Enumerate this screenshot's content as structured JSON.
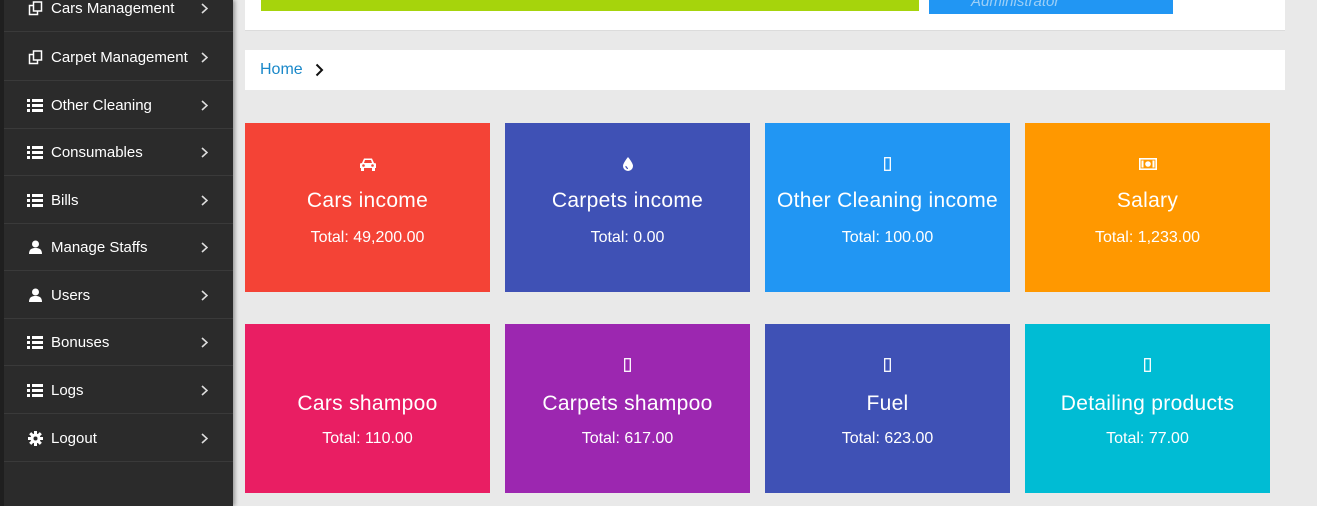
{
  "sidebar": {
    "items": [
      {
        "label": "Cars Management",
        "icon": "copy-icon"
      },
      {
        "label": "Carpet Management",
        "icon": "copy-icon"
      },
      {
        "label": "Other Cleaning",
        "icon": "list-icon"
      },
      {
        "label": "Consumables",
        "icon": "list-icon"
      },
      {
        "label": "Bills",
        "icon": "list-icon"
      },
      {
        "label": "Manage Staffs",
        "icon": "user-icon"
      },
      {
        "label": "Users",
        "icon": "user-icon"
      },
      {
        "label": "Bonuses",
        "icon": "list-icon"
      },
      {
        "label": "Logs",
        "icon": "list-icon"
      },
      {
        "label": "Logout",
        "icon": "gear-icon"
      }
    ]
  },
  "header": {
    "user_role": "Administrator"
  },
  "breadcrumb": {
    "home": "Home"
  },
  "cards": [
    {
      "title": "Cars income",
      "total": "Total: 49,200.00",
      "color": "#f44336",
      "icon": "car-icon"
    },
    {
      "title": "Carpets income",
      "total": "Total: 0.00",
      "color": "#3f51b5",
      "icon": "drop-icon"
    },
    {
      "title": "Other Cleaning income",
      "total": "Total: 100.00",
      "color": "#2196f3",
      "icon": "missing-glyph-icon"
    },
    {
      "title": "Salary",
      "total": "Total: 1,233.00",
      "color": "#ff9800",
      "icon": "money-icon"
    },
    {
      "title": "Cars shampoo",
      "total": "Total: 110.00",
      "color": "#e91e63",
      "icon": "none"
    },
    {
      "title": "Carpets shampoo",
      "total": "Total: 617.00",
      "color": "#9c27b0",
      "icon": "missing-glyph-icon"
    },
    {
      "title": "Fuel",
      "total": "Total: 623.00",
      "color": "#3f51b5",
      "icon": "missing-glyph-icon"
    },
    {
      "title": "Detailing products",
      "total": "Total: 77.00",
      "color": "#00bcd4",
      "icon": "missing-glyph-icon"
    }
  ]
}
